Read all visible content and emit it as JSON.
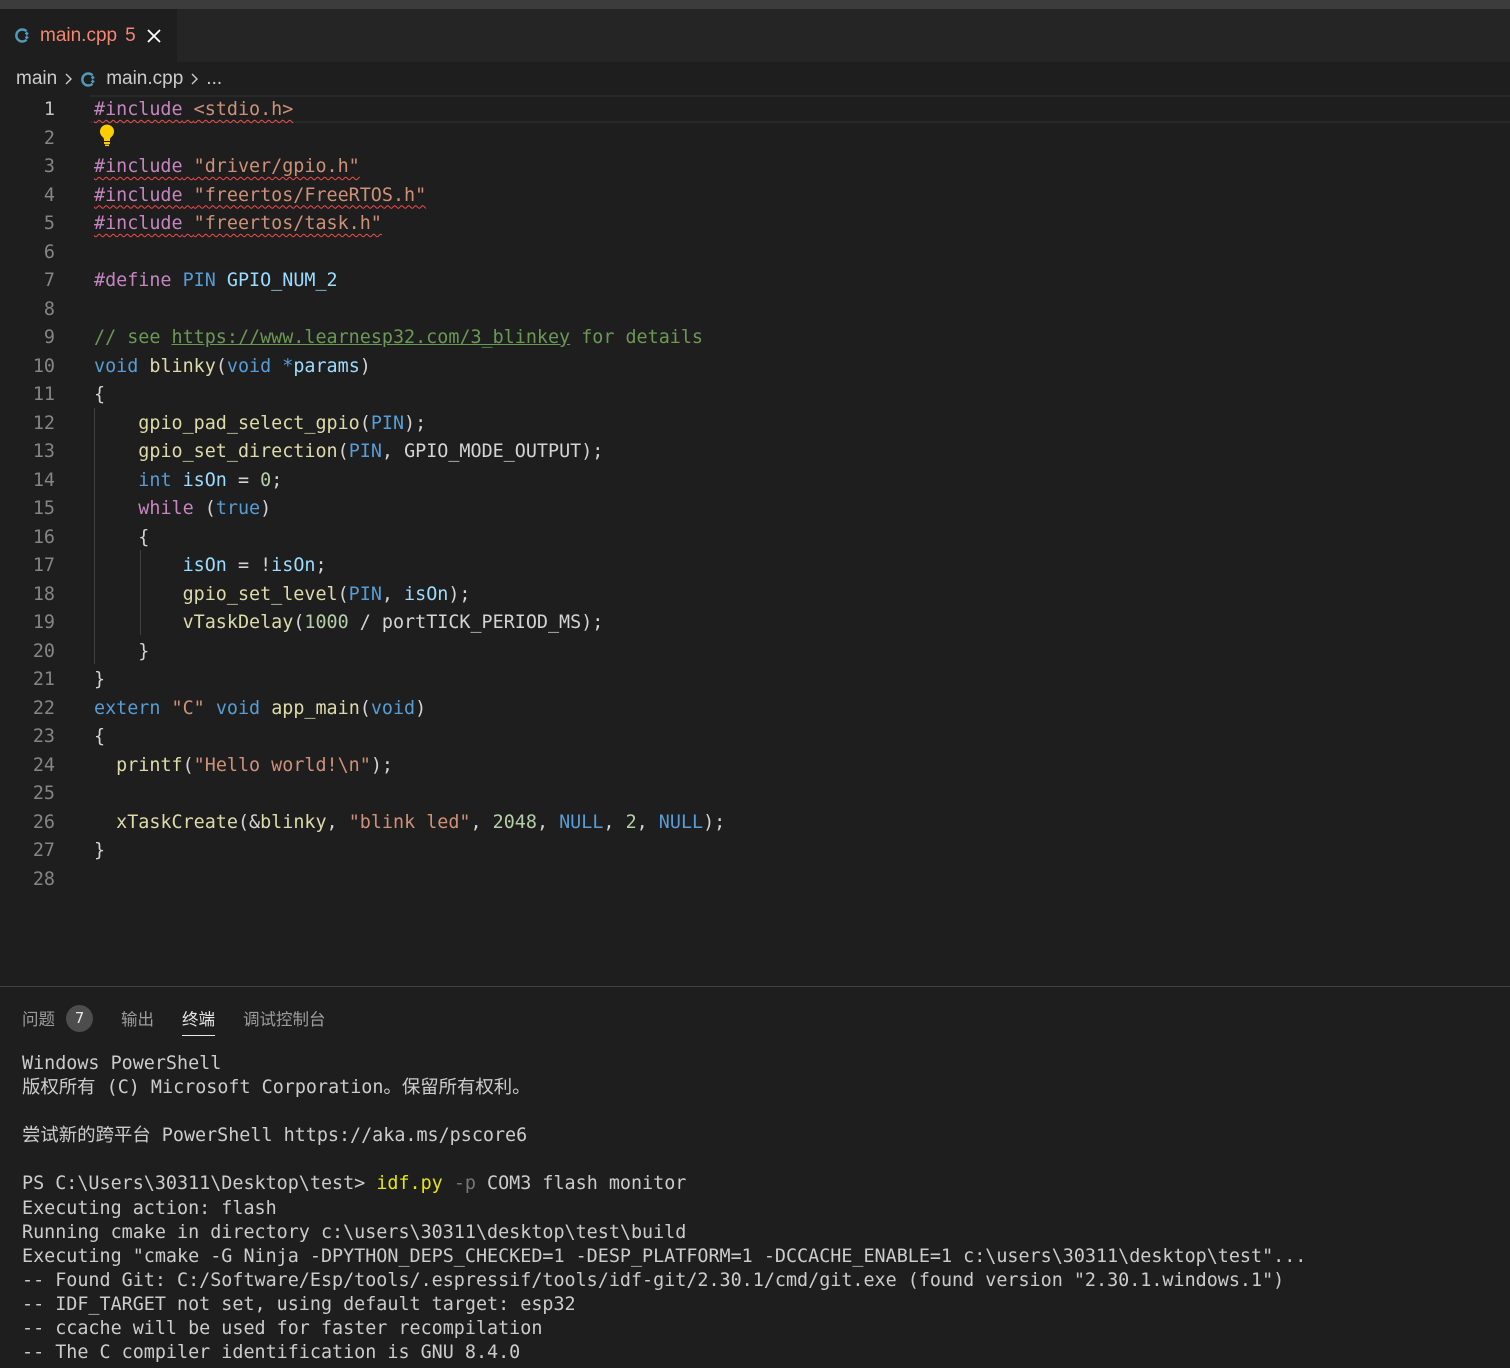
{
  "tab": {
    "file_name": "main.cpp",
    "problem_count": "5",
    "close_icon": "close-icon",
    "file_icon": "cpp-file-icon"
  },
  "breadcrumb": {
    "folder": "main",
    "file": "main.cpp",
    "more": "..."
  },
  "editor": {
    "lines": [
      {
        "n": "1",
        "html": "<span class='err'><span class='k-pp'>#include</span> <span class='k-str'>&lt;stdio.h&gt;</span></span>"
      },
      {
        "n": "2",
        "html": ""
      },
      {
        "n": "3",
        "html": "<span class='err'><span class='k-pp'>#include</span> <span class='k-str'>\"driver/gpio.h\"</span></span>"
      },
      {
        "n": "4",
        "html": "<span class='err'><span class='k-pp'>#include</span> <span class='k-str'>\"freertos/FreeRTOS.h\"</span></span>"
      },
      {
        "n": "5",
        "html": "<span class='err'><span class='k-pp'>#include</span> <span class='k-str'>\"freertos/task.h\"</span></span>"
      },
      {
        "n": "6",
        "html": ""
      },
      {
        "n": "7",
        "html": "<span class='k-pp'>#define</span> <span class='k-mac'>PIN</span> <span class='k-var'>GPIO_NUM_2</span>"
      },
      {
        "n": "8",
        "html": ""
      },
      {
        "n": "9",
        "html": "<span class='k-cmt'>// see <span class='link'>https://www.learnesp32.com/3_blinkey</span> for details</span>"
      },
      {
        "n": "10",
        "html": "<span class='k-kw'>void</span> <span class='k-fn'>blinky</span>(<span class='k-kw'>void</span> <span class='k-kw'>*</span><span class='k-var'>params</span>)"
      },
      {
        "n": "11",
        "html": "{"
      },
      {
        "n": "12",
        "html": "    <span class='k-fn'>gpio_pad_select_gpio</span>(<span class='k-mac'>PIN</span>);"
      },
      {
        "n": "13",
        "html": "    <span class='k-fn'>gpio_set_direction</span>(<span class='k-mac'>PIN</span>, <span class='k-plain'>GPIO_MODE_OUTPUT</span>);"
      },
      {
        "n": "14",
        "html": "    <span class='k-kw'>int</span> <span class='k-var'>isOn</span> = <span class='k-num'>0</span>;"
      },
      {
        "n": "15",
        "html": "    <span class='k-ctrl'>while</span> (<span class='k-kw'>true</span>)"
      },
      {
        "n": "16",
        "html": "    {"
      },
      {
        "n": "17",
        "html": "        <span class='k-var'>isOn</span> = !<span class='k-var'>isOn</span>;"
      },
      {
        "n": "18",
        "html": "        <span class='k-fn'>gpio_set_level</span>(<span class='k-mac'>PIN</span>, <span class='k-var'>isOn</span>);"
      },
      {
        "n": "19",
        "html": "        <span class='k-fn'>vTaskDelay</span>(<span class='k-num'>1000</span> / <span class='k-plain'>portTICK_PERIOD_MS</span>);"
      },
      {
        "n": "20",
        "html": "    }"
      },
      {
        "n": "21",
        "html": "}"
      },
      {
        "n": "22",
        "html": "<span class='k-kw'>extern</span> <span class='k-str'>\"C\"</span> <span class='k-kw'>void</span> <span class='k-fn'>app_main</span>(<span class='k-kw'>void</span>)"
      },
      {
        "n": "23",
        "html": "{"
      },
      {
        "n": "24",
        "html": "  <span class='k-fn'>printf</span>(<span class='k-str'>\"Hello world!\\n\"</span>);"
      },
      {
        "n": "25",
        "html": ""
      },
      {
        "n": "26",
        "html": "  <span class='k-fn'>xTaskCreate</span>(&amp;<span class='k-fn'>blinky</span>, <span class='k-str'>\"blink led\"</span>, <span class='k-num'>2048</span>, <span class='k-mac'>NULL</span>, <span class='k-num'>2</span>, <span class='k-mac'>NULL</span>);"
      },
      {
        "n": "27",
        "html": "}"
      },
      {
        "n": "28",
        "html": ""
      }
    ],
    "lightbulb_icon": "lightbulb-icon"
  },
  "panel": {
    "tabs": [
      {
        "label": "问题",
        "badge": "7"
      },
      {
        "label": "输出"
      },
      {
        "label": "终端",
        "active": true
      },
      {
        "label": "调试控制台"
      }
    ]
  },
  "terminal": {
    "lines": [
      {
        "text": "Windows PowerShell"
      },
      {
        "text": "版权所有 (C) Microsoft Corporation。保留所有权利。"
      },
      {
        "text": ""
      },
      {
        "text": "尝试新的跨平台 PowerShell https://aka.ms/pscore6"
      },
      {
        "text": ""
      },
      {
        "prompt": "PS C:\\Users\\30311\\Desktop\\test> ",
        "cmd": "idf.py",
        "flag": " -p",
        "rest": " COM3 flash monitor"
      },
      {
        "text": "Executing action: flash"
      },
      {
        "text": "Running cmake in directory c:\\users\\30311\\desktop\\test\\build"
      },
      {
        "text": "Executing \"cmake -G Ninja -DPYTHON_DEPS_CHECKED=1 -DESP_PLATFORM=1 -DCCACHE_ENABLE=1 c:\\users\\30311\\desktop\\test\"..."
      },
      {
        "text": "-- Found Git: C:/Software/Esp/tools/.espressif/tools/idf-git/2.30.1/cmd/git.exe (found version \"2.30.1.windows.1\")"
      },
      {
        "text": "-- IDF_TARGET not set, using default target: esp32"
      },
      {
        "text": "-- ccache will be used for faster recompilation"
      },
      {
        "text": "-- The C compiler identification is GNU 8.4.0"
      }
    ]
  },
  "colors": {
    "tab_error": "#f48771",
    "cpp_icon": "#519aba",
    "squiggle": "#f14c4c",
    "bulb": "#ffcc00"
  }
}
